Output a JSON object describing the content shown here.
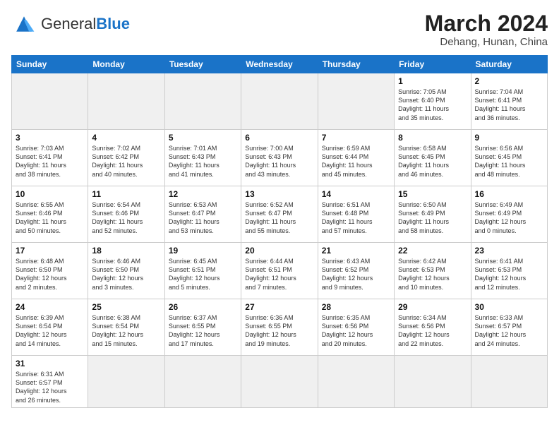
{
  "header": {
    "logo_text_normal": "General",
    "logo_text_blue": "Blue",
    "month_year": "March 2024",
    "location": "Dehang, Hunan, China"
  },
  "days_of_week": [
    "Sunday",
    "Monday",
    "Tuesday",
    "Wednesday",
    "Thursday",
    "Friday",
    "Saturday"
  ],
  "weeks": [
    [
      {
        "day": "",
        "info": "",
        "empty": true
      },
      {
        "day": "",
        "info": "",
        "empty": true
      },
      {
        "day": "",
        "info": "",
        "empty": true
      },
      {
        "day": "",
        "info": "",
        "empty": true
      },
      {
        "day": "",
        "info": "",
        "empty": true
      },
      {
        "day": "1",
        "info": "Sunrise: 7:05 AM\nSunset: 6:40 PM\nDaylight: 11 hours\nand 35 minutes.",
        "empty": false
      },
      {
        "day": "2",
        "info": "Sunrise: 7:04 AM\nSunset: 6:41 PM\nDaylight: 11 hours\nand 36 minutes.",
        "empty": false
      }
    ],
    [
      {
        "day": "3",
        "info": "Sunrise: 7:03 AM\nSunset: 6:41 PM\nDaylight: 11 hours\nand 38 minutes.",
        "empty": false
      },
      {
        "day": "4",
        "info": "Sunrise: 7:02 AM\nSunset: 6:42 PM\nDaylight: 11 hours\nand 40 minutes.",
        "empty": false
      },
      {
        "day": "5",
        "info": "Sunrise: 7:01 AM\nSunset: 6:43 PM\nDaylight: 11 hours\nand 41 minutes.",
        "empty": false
      },
      {
        "day": "6",
        "info": "Sunrise: 7:00 AM\nSunset: 6:43 PM\nDaylight: 11 hours\nand 43 minutes.",
        "empty": false
      },
      {
        "day": "7",
        "info": "Sunrise: 6:59 AM\nSunset: 6:44 PM\nDaylight: 11 hours\nand 45 minutes.",
        "empty": false
      },
      {
        "day": "8",
        "info": "Sunrise: 6:58 AM\nSunset: 6:45 PM\nDaylight: 11 hours\nand 46 minutes.",
        "empty": false
      },
      {
        "day": "9",
        "info": "Sunrise: 6:56 AM\nSunset: 6:45 PM\nDaylight: 11 hours\nand 48 minutes.",
        "empty": false
      }
    ],
    [
      {
        "day": "10",
        "info": "Sunrise: 6:55 AM\nSunset: 6:46 PM\nDaylight: 11 hours\nand 50 minutes.",
        "empty": false
      },
      {
        "day": "11",
        "info": "Sunrise: 6:54 AM\nSunset: 6:46 PM\nDaylight: 11 hours\nand 52 minutes.",
        "empty": false
      },
      {
        "day": "12",
        "info": "Sunrise: 6:53 AM\nSunset: 6:47 PM\nDaylight: 11 hours\nand 53 minutes.",
        "empty": false
      },
      {
        "day": "13",
        "info": "Sunrise: 6:52 AM\nSunset: 6:47 PM\nDaylight: 11 hours\nand 55 minutes.",
        "empty": false
      },
      {
        "day": "14",
        "info": "Sunrise: 6:51 AM\nSunset: 6:48 PM\nDaylight: 11 hours\nand 57 minutes.",
        "empty": false
      },
      {
        "day": "15",
        "info": "Sunrise: 6:50 AM\nSunset: 6:49 PM\nDaylight: 11 hours\nand 58 minutes.",
        "empty": false
      },
      {
        "day": "16",
        "info": "Sunrise: 6:49 AM\nSunset: 6:49 PM\nDaylight: 12 hours\nand 0 minutes.",
        "empty": false
      }
    ],
    [
      {
        "day": "17",
        "info": "Sunrise: 6:48 AM\nSunset: 6:50 PM\nDaylight: 12 hours\nand 2 minutes.",
        "empty": false
      },
      {
        "day": "18",
        "info": "Sunrise: 6:46 AM\nSunset: 6:50 PM\nDaylight: 12 hours\nand 3 minutes.",
        "empty": false
      },
      {
        "day": "19",
        "info": "Sunrise: 6:45 AM\nSunset: 6:51 PM\nDaylight: 12 hours\nand 5 minutes.",
        "empty": false
      },
      {
        "day": "20",
        "info": "Sunrise: 6:44 AM\nSunset: 6:51 PM\nDaylight: 12 hours\nand 7 minutes.",
        "empty": false
      },
      {
        "day": "21",
        "info": "Sunrise: 6:43 AM\nSunset: 6:52 PM\nDaylight: 12 hours\nand 9 minutes.",
        "empty": false
      },
      {
        "day": "22",
        "info": "Sunrise: 6:42 AM\nSunset: 6:53 PM\nDaylight: 12 hours\nand 10 minutes.",
        "empty": false
      },
      {
        "day": "23",
        "info": "Sunrise: 6:41 AM\nSunset: 6:53 PM\nDaylight: 12 hours\nand 12 minutes.",
        "empty": false
      }
    ],
    [
      {
        "day": "24",
        "info": "Sunrise: 6:39 AM\nSunset: 6:54 PM\nDaylight: 12 hours\nand 14 minutes.",
        "empty": false
      },
      {
        "day": "25",
        "info": "Sunrise: 6:38 AM\nSunset: 6:54 PM\nDaylight: 12 hours\nand 15 minutes.",
        "empty": false
      },
      {
        "day": "26",
        "info": "Sunrise: 6:37 AM\nSunset: 6:55 PM\nDaylight: 12 hours\nand 17 minutes.",
        "empty": false
      },
      {
        "day": "27",
        "info": "Sunrise: 6:36 AM\nSunset: 6:55 PM\nDaylight: 12 hours\nand 19 minutes.",
        "empty": false
      },
      {
        "day": "28",
        "info": "Sunrise: 6:35 AM\nSunset: 6:56 PM\nDaylight: 12 hours\nand 20 minutes.",
        "empty": false
      },
      {
        "day": "29",
        "info": "Sunrise: 6:34 AM\nSunset: 6:56 PM\nDaylight: 12 hours\nand 22 minutes.",
        "empty": false
      },
      {
        "day": "30",
        "info": "Sunrise: 6:33 AM\nSunset: 6:57 PM\nDaylight: 12 hours\nand 24 minutes.",
        "empty": false
      }
    ],
    [
      {
        "day": "31",
        "info": "Sunrise: 6:31 AM\nSunset: 6:57 PM\nDaylight: 12 hours\nand 26 minutes.",
        "empty": false
      },
      {
        "day": "",
        "info": "",
        "empty": true
      },
      {
        "day": "",
        "info": "",
        "empty": true
      },
      {
        "day": "",
        "info": "",
        "empty": true
      },
      {
        "day": "",
        "info": "",
        "empty": true
      },
      {
        "day": "",
        "info": "",
        "empty": true
      },
      {
        "day": "",
        "info": "",
        "empty": true
      }
    ]
  ]
}
